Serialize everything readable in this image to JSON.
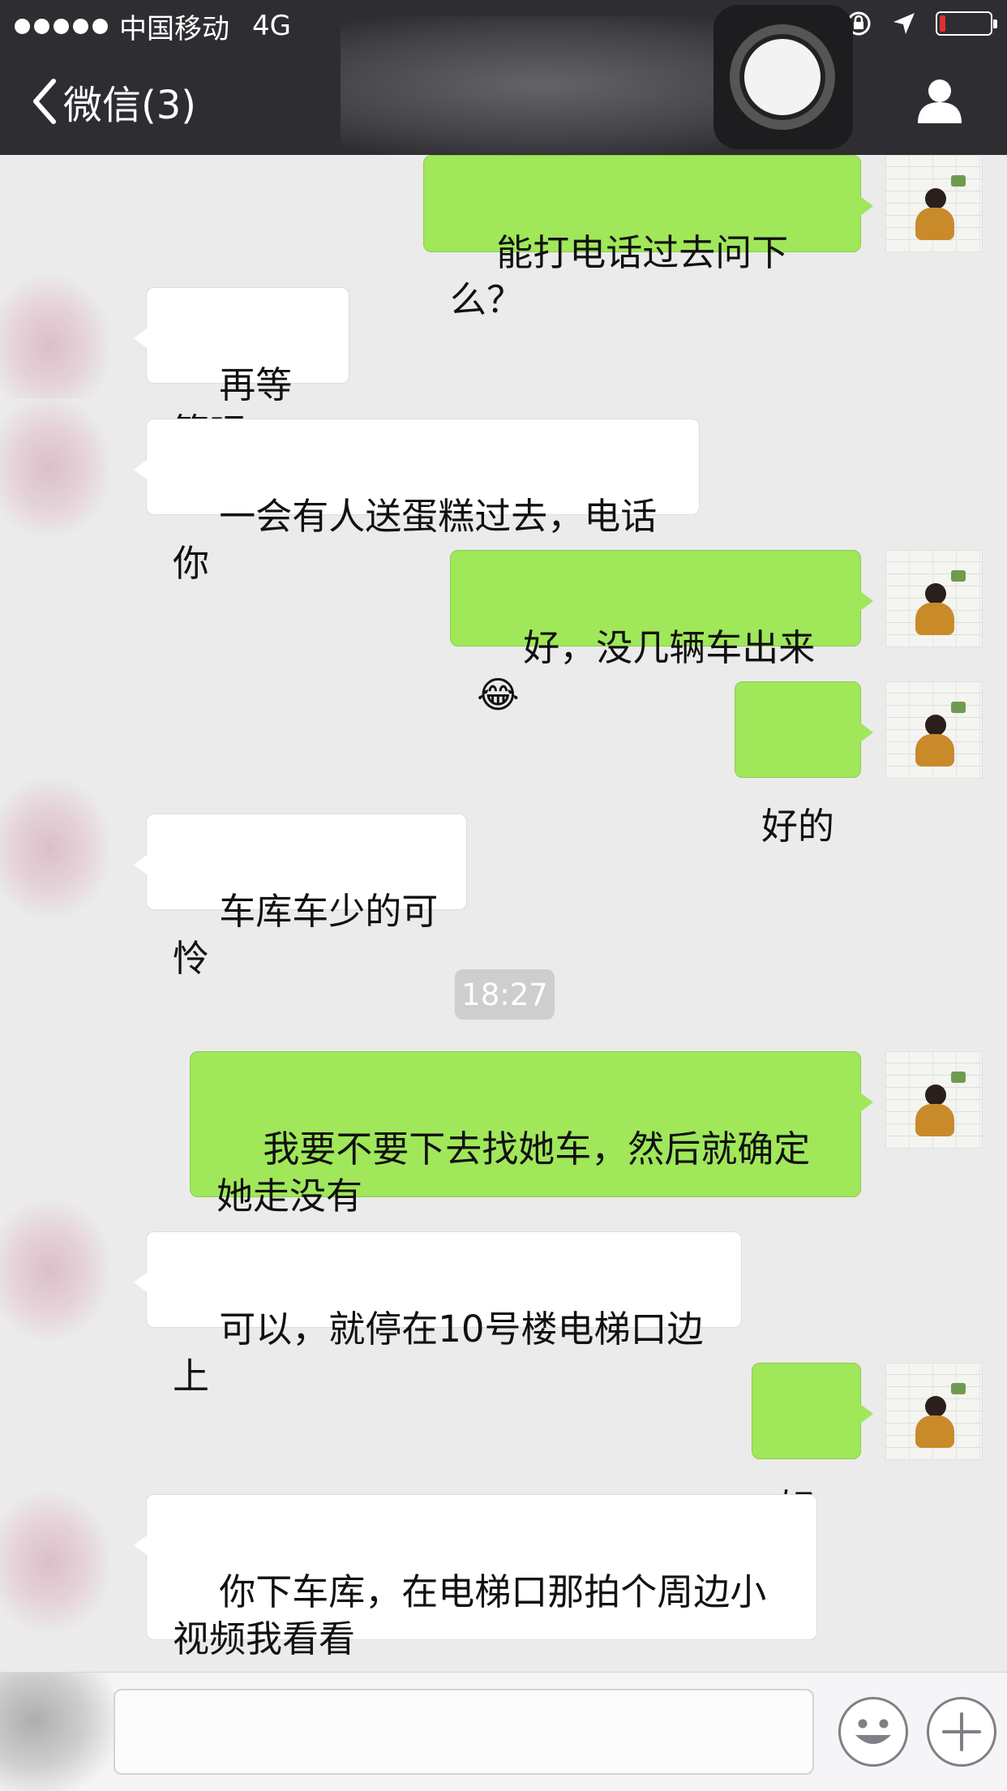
{
  "status_bar": {
    "carrier": "中国移动",
    "network": "4G",
    "battery_level": 0.12,
    "battery_color": "#e03030"
  },
  "nav": {
    "back_label": "微信(3)",
    "back_icon": "chevron-left-icon",
    "contact_icon": "person-icon"
  },
  "messages": [
    {
      "side": "me",
      "text": "能打电话过去问下么？"
    },
    {
      "side": "other",
      "text": "再等等吧"
    },
    {
      "side": "other",
      "text": "一会有人送蛋糕过去，电话你"
    },
    {
      "side": "me",
      "text": "好，没几辆车出来😂"
    },
    {
      "side": "me",
      "text": "好的"
    },
    {
      "side": "other",
      "text": "车库车少的可怜"
    },
    {
      "side": "me",
      "text": "我要不要下去找她车，然后就确定她走没有"
    },
    {
      "side": "other",
      "text": "可以，就停在10号楼电梯口边上"
    },
    {
      "side": "me",
      "text": "好"
    },
    {
      "side": "other",
      "text": "你下车库，在电梯口那拍个周边小视频我看看"
    }
  ],
  "timestamp": "18:27",
  "input_bar": {
    "emoji_icon": "smiley-icon",
    "plus_icon": "plus-icon"
  },
  "colors": {
    "nav_bg": "#2e2e32",
    "chat_bg": "#ebebeb",
    "my_bubble": "#a0e75a",
    "their_bubble": "#ffffff"
  }
}
